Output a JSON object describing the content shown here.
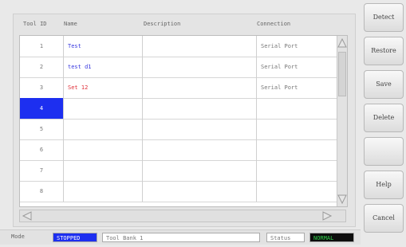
{
  "table": {
    "headers": {
      "tool_id": "Tool ID",
      "name": "Name",
      "description": "Description",
      "connection": "Connection"
    },
    "rows": [
      {
        "id": "1",
        "name": "Test",
        "description": "",
        "connection": "Serial Port",
        "name_color": "#3a3adf"
      },
      {
        "id": "2",
        "name": "test d1",
        "description": "",
        "connection": "Serial Port",
        "name_color": "#3a3adf"
      },
      {
        "id": "3",
        "name": "Set 12",
        "description": "",
        "connection": "Serial Port",
        "name_color": "#e0303a"
      },
      {
        "id": "4",
        "name": "",
        "description": "",
        "connection": "",
        "selected": true
      },
      {
        "id": "5",
        "name": "",
        "description": "",
        "connection": ""
      },
      {
        "id": "6",
        "name": "",
        "description": "",
        "connection": ""
      },
      {
        "id": "7",
        "name": "",
        "description": "",
        "connection": ""
      },
      {
        "id": "8",
        "name": "",
        "description": "",
        "connection": ""
      }
    ]
  },
  "buttons": {
    "detect": "Detect",
    "restore": "Restore",
    "save": "Save",
    "delete": "Delete",
    "blank": "",
    "help": "Help",
    "cancel": "Cancel"
  },
  "status_bar": {
    "mode_label": "Mode",
    "mode_value": "STOPPED",
    "tool_bank": "Tool Bank 1",
    "status_label": "Status",
    "status_value": "NORMAL"
  },
  "colors": {
    "selection": "#1d2ff0",
    "mode_bg": "#1d2ff0",
    "status_bg": "#0d0d0d",
    "status_text": "#2fd14a"
  }
}
